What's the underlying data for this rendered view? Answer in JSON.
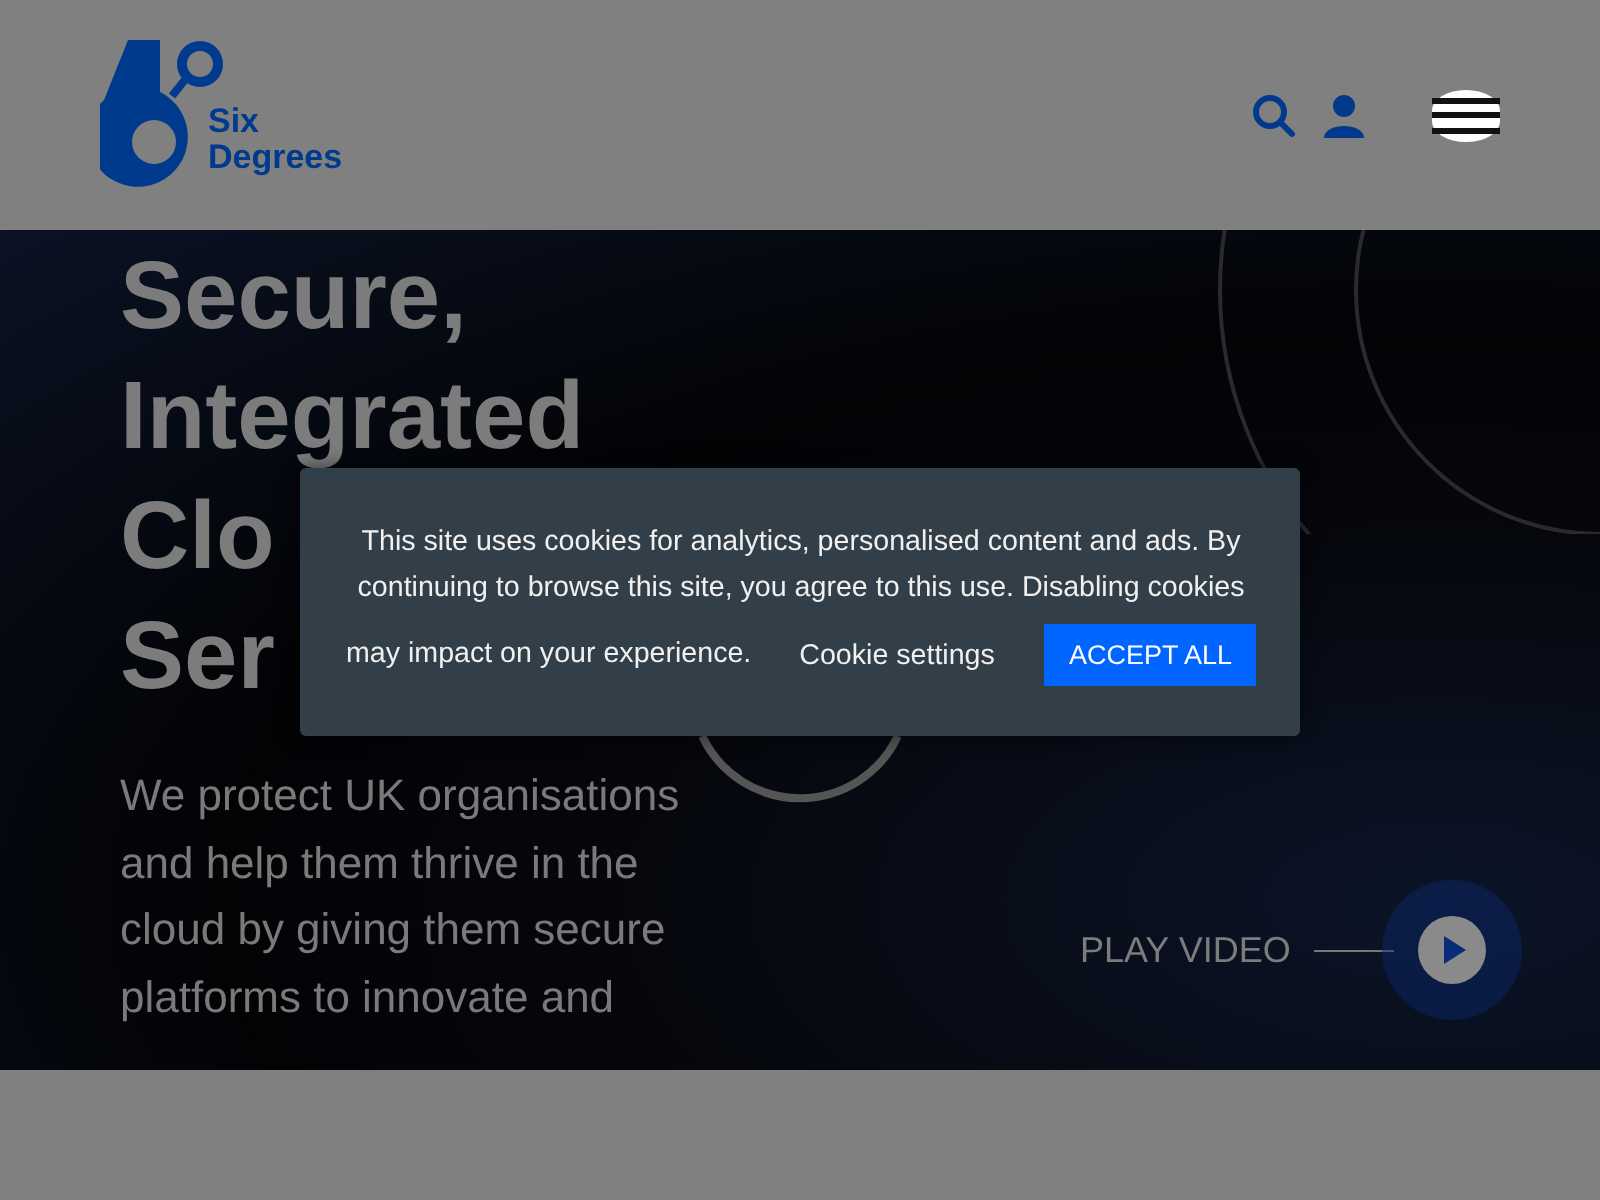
{
  "header": {
    "logo": {
      "text_lines": [
        "Six",
        "Degrees"
      ]
    }
  },
  "hero": {
    "heading_lines": [
      "Secure,",
      "Integrated",
      "Clo",
      "Ser"
    ],
    "paragraph_lines": [
      "We protect UK organisations",
      "and help them thrive in the",
      "cloud by giving them secure",
      "platforms to innovate and"
    ],
    "play_video": "PLAY VIDEO"
  },
  "cookie_banner": {
    "message_lines": [
      "This site uses cookies for analytics, personalised content and ads. By",
      "continuing to browse this site, you agree to this use. Disabling cookies"
    ],
    "last_line": "may impact on your experience.",
    "settings_link": "Cookie settings",
    "accept_button": "ACCEPT ALL"
  }
}
